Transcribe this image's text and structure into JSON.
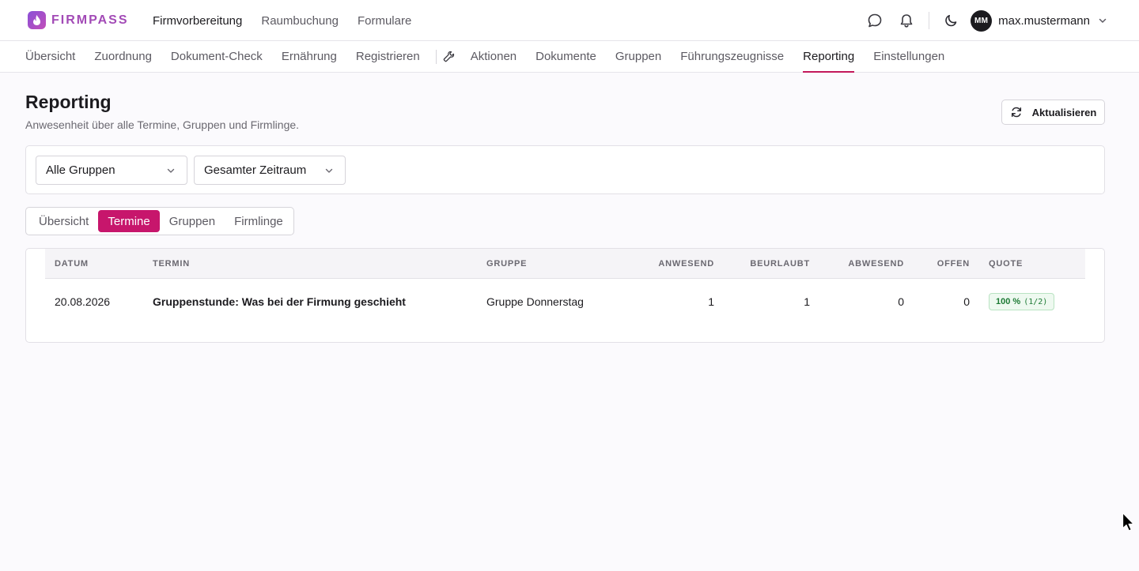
{
  "app": {
    "brand": "FIRMPASS",
    "main_nav": [
      {
        "label": "Firmvorbereitung",
        "active": true
      },
      {
        "label": "Raumbuchung",
        "active": false
      },
      {
        "label": "Formulare",
        "active": false
      }
    ],
    "user": {
      "initials": "MM",
      "name": "max.mustermann"
    },
    "header_icons": [
      "chat-icon",
      "bell-icon",
      "moon-icon",
      "chevron-down-icon"
    ]
  },
  "subnav": {
    "tabs_left": [
      "Übersicht",
      "Zuordnung",
      "Dokument-Check",
      "Ernährung",
      "Registrieren"
    ],
    "tool_icon": "wrench-icon",
    "tabs_right": [
      "Aktionen",
      "Dokumente",
      "Gruppen",
      "Führungszeugnisse",
      "Reporting",
      "Einstellungen"
    ],
    "active": "Reporting"
  },
  "page": {
    "title": "Reporting",
    "subtitle": "Anwesenheit über alle Termine, Gruppen und Firmlinge.",
    "refresh_label": "Aktualisieren"
  },
  "filters": {
    "groups_value": "Alle Gruppen",
    "period_value": "Gesamter Zeitraum"
  },
  "view_tabs": {
    "items": [
      "Übersicht",
      "Termine",
      "Gruppen",
      "Firmlinge"
    ],
    "active": "Termine"
  },
  "table": {
    "headers": {
      "date": "DATUM",
      "event": "TERMIN",
      "group": "GRUPPE",
      "present": "ANWESEND",
      "excused": "BEURLAUBT",
      "absent": "ABWESEND",
      "open": "OFFEN",
      "quota": "QUOTE"
    },
    "rows": [
      {
        "date": "20.08.2026",
        "event": "Gruppenstunde: Was bei der Firmung geschieht",
        "group": "Gruppe Donnerstag",
        "present": "1",
        "excused": "1",
        "absent": "0",
        "open": "0",
        "quota_pct": "100 %",
        "quota_frac": "(1/2)"
      }
    ]
  },
  "colors": {
    "accent": "#c7166c",
    "brand": "#a24ab6",
    "badge_green": "#1d7a34"
  }
}
